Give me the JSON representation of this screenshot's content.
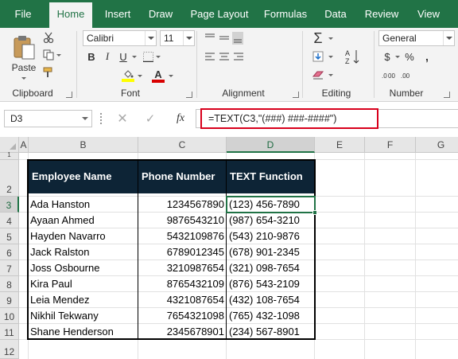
{
  "ribbon": {
    "tabs": [
      "File",
      "Home",
      "Insert",
      "Draw",
      "Page Layout",
      "Formulas",
      "Data",
      "Review",
      "View"
    ],
    "active_tab": "Home",
    "groups": {
      "clipboard": "Clipboard",
      "font": "Font",
      "alignment": "Alignment",
      "editing": "Editing",
      "number": "Number"
    },
    "paste_label": "Paste",
    "font_name": "Calibri",
    "font_size": "11",
    "number_format": "General",
    "bold_label": "B",
    "italic_label": "I",
    "underline_label": "U",
    "grow_font": "A˄",
    "shrink_font": "A˅",
    "currency_symbol": "$",
    "percent_symbol": "%",
    "comma_symbol": ",",
    "highlight_color": "#ffff00",
    "font_color": "#d80000",
    "accent_color": "#217346"
  },
  "formula_bar": {
    "name_box": "D3",
    "fx_label": "fx",
    "formula": "=TEXT(C3,\"(###) ###-####\")"
  },
  "sheet": {
    "columns": [
      "A",
      "B",
      "C",
      "D",
      "E",
      "F",
      "G"
    ],
    "rows": [
      "1",
      "2",
      "3",
      "4",
      "5",
      "6",
      "7",
      "8",
      "9",
      "10",
      "11",
      "12"
    ],
    "headers": [
      "Employee Name",
      "Phone Number",
      "TEXT Function"
    ],
    "data": [
      [
        "Ada Hanston",
        "1234567890",
        "(123) 456-7890"
      ],
      [
        "Ayaan Ahmed",
        "9876543210",
        "(987) 654-3210"
      ],
      [
        "Hayden Navarro",
        "5432109876",
        "(543) 210-9876"
      ],
      [
        "Jack Ralston",
        "6789012345",
        "(678) 901-2345"
      ],
      [
        "Joss Osbourne",
        "3210987654",
        "(321) 098-7654"
      ],
      [
        "Kira Paul",
        "8765432109",
        "(876) 543-2109"
      ],
      [
        "Leia Mendez",
        "4321087654",
        "(432) 108-7654"
      ],
      [
        "Nikhil Tekwany",
        "7654321098",
        "(765) 432-1098"
      ],
      [
        "Shane Henderson",
        "2345678901",
        "(234) 567-8901"
      ]
    ],
    "header_fill": "#0d2436",
    "selected_cell": "D3"
  }
}
